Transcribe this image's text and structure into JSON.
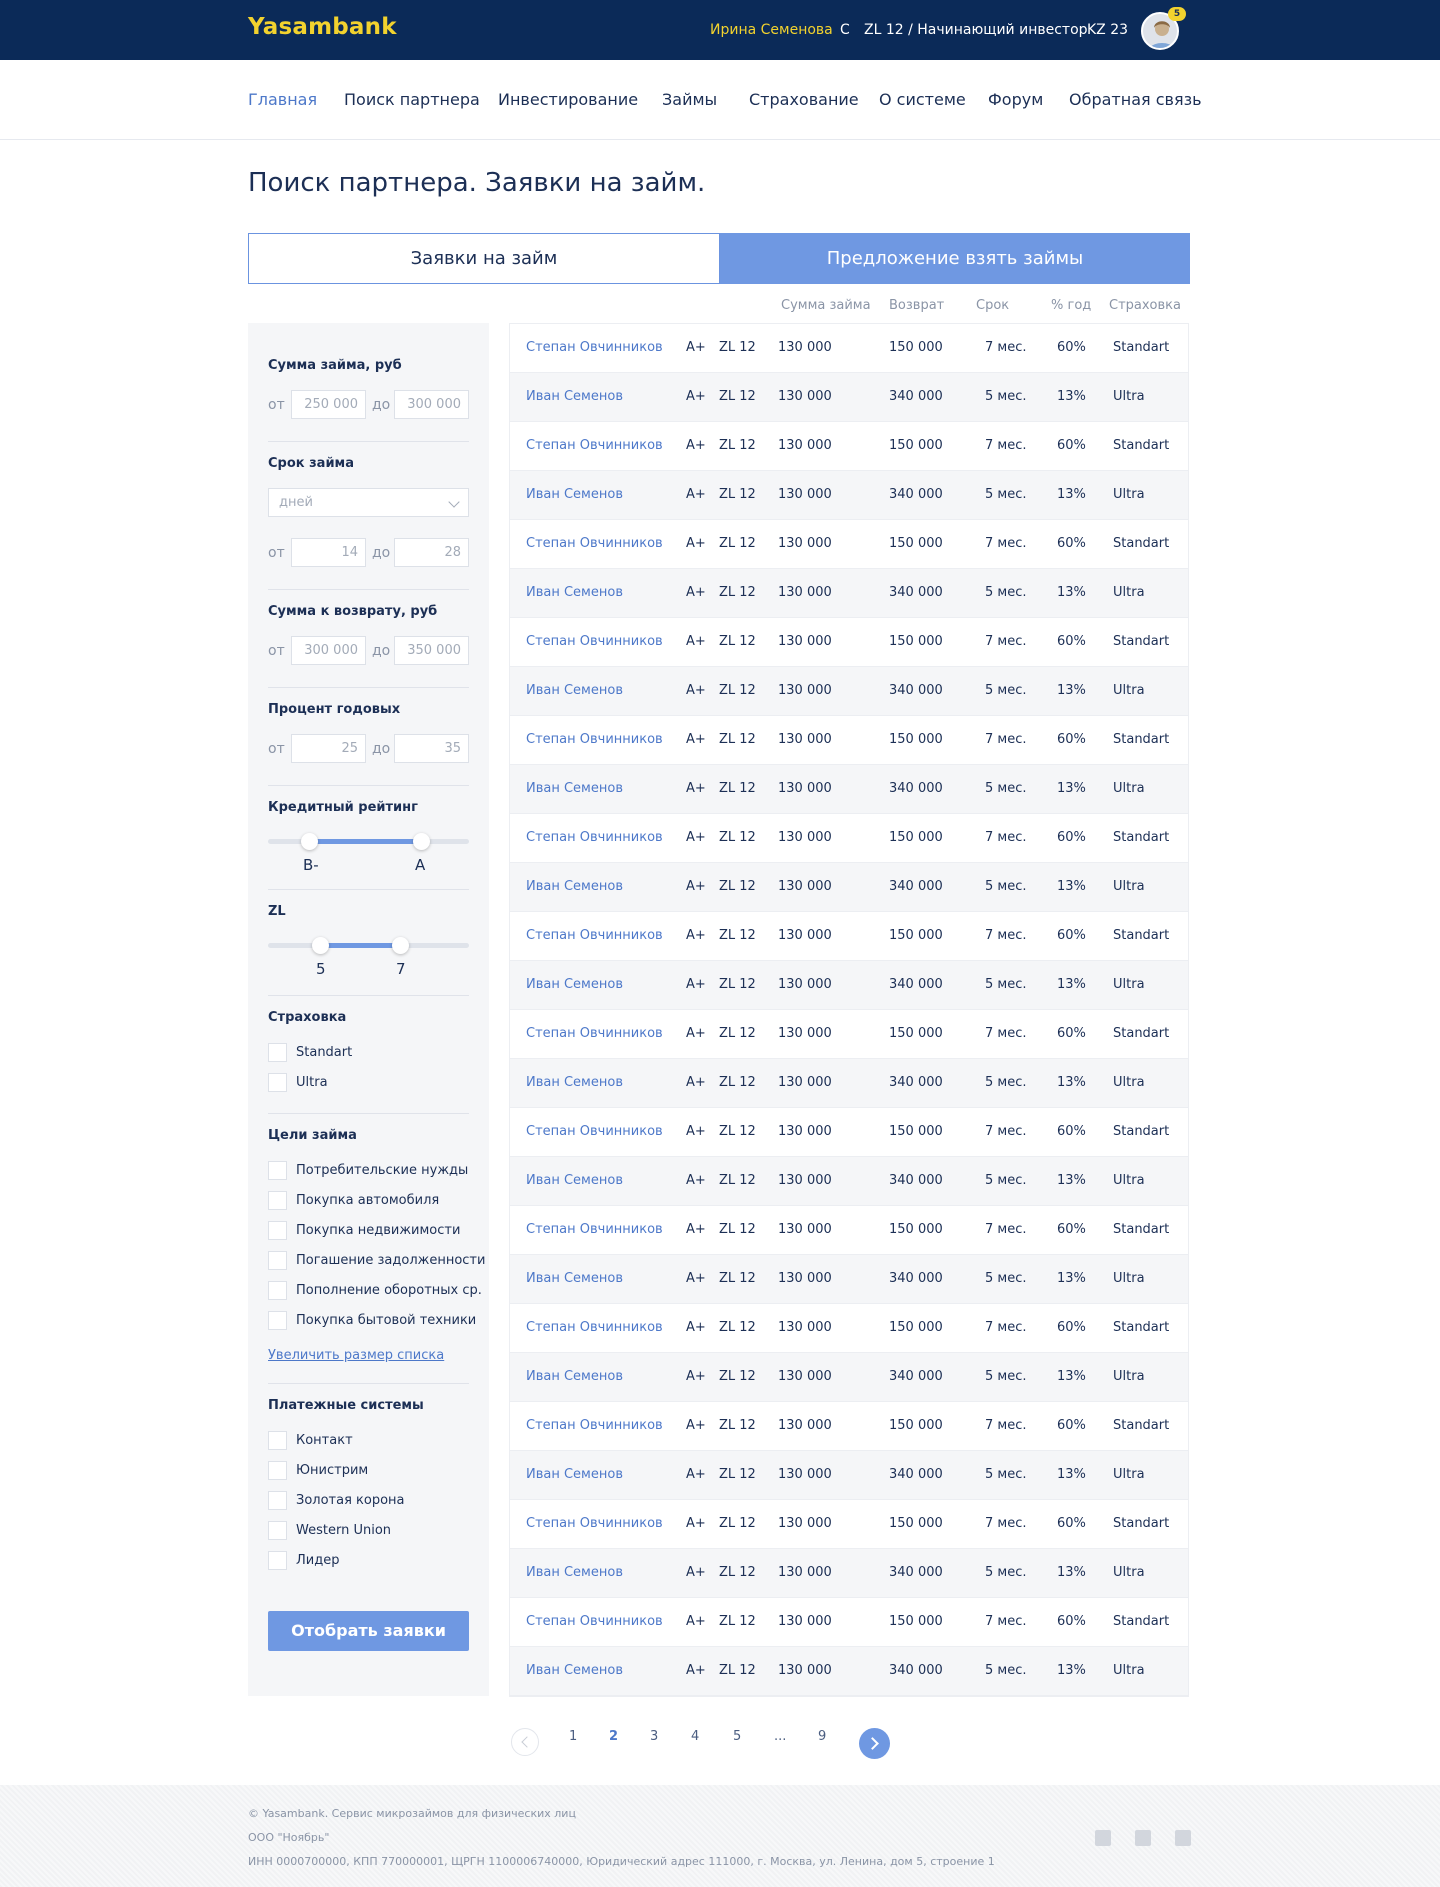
{
  "header": {
    "logo": "Yasambank",
    "user_name": "Ирина Семенова",
    "rank": "C",
    "zl_status": "ZL 12 / Начинающий инвестор",
    "kz": "KZ 23",
    "notifications": "5"
  },
  "nav": {
    "items": [
      "Главная",
      "Поиск партнера",
      "Инвестирование",
      "Займы",
      "Страхование",
      "О системе",
      "Форум",
      "Обратная связь"
    ],
    "active": 0
  },
  "page": {
    "title": "Поиск партнера. Заявки на займ."
  },
  "tabs": [
    "Заявки на займ",
    "Предложение взять займы"
  ],
  "columns": {
    "amount": "Сумма займа",
    "return": "Возврат",
    "term": "Срок",
    "rate": "% год",
    "insurance": "Страховка"
  },
  "filters": {
    "sum_label": "Сумма займа, руб",
    "from": "от",
    "to": "до",
    "sum_from": "250 000",
    "sum_to": "300 000",
    "term_label": "Срок займа",
    "term_unit": "дней",
    "term_from": "14",
    "term_to": "28",
    "return_label": "Сумма к возврату, руб",
    "return_from": "300 000",
    "return_to": "350 000",
    "rate_label": "Процент годовых",
    "rate_from": "25",
    "rate_to": "35",
    "rating_label": "Кредитный рейтинг",
    "rating_min": "B-",
    "rating_max": "A",
    "zl_label": "ZL",
    "zl_min": "5",
    "zl_max": "7",
    "insurance_label": "Страховка",
    "insurance_options": [
      "Standart",
      "Ultra"
    ],
    "goals_label": "Цели займа",
    "goals": [
      "Потребительские нужды",
      "Покупка автомобиля",
      "Покупка недвижимости",
      "Погашение задолженности",
      "Пополнение оборотных ср.",
      "Покупка бытовой техники"
    ],
    "more_link": "Увеличить размер списка",
    "payments_label": "Платежные системы",
    "payments": [
      "Контакт",
      "Юнистрим",
      "Золотая корона",
      "Western Union",
      "Лидер"
    ],
    "submit": "Отобрать заявки"
  },
  "rows": [
    {
      "name": "Степан Овчинников",
      "rating": "A+",
      "zl": "ZL 12",
      "amount": "130 000",
      "return": "150 000",
      "term": "7 мес.",
      "rate": "60%",
      "insurance": "Standart"
    },
    {
      "name": "Иван Семенов",
      "rating": "A+",
      "zl": "ZL 12",
      "amount": "130 000",
      "return": "340 000",
      "term": "5 мес.",
      "rate": "13%",
      "insurance": "Ultra"
    },
    {
      "name": "Степан Овчинников",
      "rating": "A+",
      "zl": "ZL 12",
      "amount": "130 000",
      "return": "150 000",
      "term": "7 мес.",
      "rate": "60%",
      "insurance": "Standart"
    },
    {
      "name": "Иван Семенов",
      "rating": "A+",
      "zl": "ZL 12",
      "amount": "130 000",
      "return": "340 000",
      "term": "5 мес.",
      "rate": "13%",
      "insurance": "Ultra"
    },
    {
      "name": "Степан Овчинников",
      "rating": "A+",
      "zl": "ZL 12",
      "amount": "130 000",
      "return": "150 000",
      "term": "7 мес.",
      "rate": "60%",
      "insurance": "Standart"
    },
    {
      "name": "Иван Семенов",
      "rating": "A+",
      "zl": "ZL 12",
      "amount": "130 000",
      "return": "340 000",
      "term": "5 мес.",
      "rate": "13%",
      "insurance": "Ultra"
    },
    {
      "name": "Степан Овчинников",
      "rating": "A+",
      "zl": "ZL 12",
      "amount": "130 000",
      "return": "150 000",
      "term": "7 мес.",
      "rate": "60%",
      "insurance": "Standart"
    },
    {
      "name": "Иван Семенов",
      "rating": "A+",
      "zl": "ZL 12",
      "amount": "130 000",
      "return": "340 000",
      "term": "5 мес.",
      "rate": "13%",
      "insurance": "Ultra"
    },
    {
      "name": "Степан Овчинников",
      "rating": "A+",
      "zl": "ZL 12",
      "amount": "130 000",
      "return": "150 000",
      "term": "7 мес.",
      "rate": "60%",
      "insurance": "Standart"
    },
    {
      "name": "Иван Семенов",
      "rating": "A+",
      "zl": "ZL 12",
      "amount": "130 000",
      "return": "340 000",
      "term": "5 мес.",
      "rate": "13%",
      "insurance": "Ultra"
    },
    {
      "name": "Степан Овчинников",
      "rating": "A+",
      "zl": "ZL 12",
      "amount": "130 000",
      "return": "150 000",
      "term": "7 мес.",
      "rate": "60%",
      "insurance": "Standart"
    },
    {
      "name": "Иван Семенов",
      "rating": "A+",
      "zl": "ZL 12",
      "amount": "130 000",
      "return": "340 000",
      "term": "5 мес.",
      "rate": "13%",
      "insurance": "Ultra"
    },
    {
      "name": "Степан Овчинников",
      "rating": "A+",
      "zl": "ZL 12",
      "amount": "130 000",
      "return": "150 000",
      "term": "7 мес.",
      "rate": "60%",
      "insurance": "Standart"
    },
    {
      "name": "Иван Семенов",
      "rating": "A+",
      "zl": "ZL 12",
      "amount": "130 000",
      "return": "340 000",
      "term": "5 мес.",
      "rate": "13%",
      "insurance": "Ultra"
    },
    {
      "name": "Степан Овчинников",
      "rating": "A+",
      "zl": "ZL 12",
      "amount": "130 000",
      "return": "150 000",
      "term": "7 мес.",
      "rate": "60%",
      "insurance": "Standart"
    },
    {
      "name": "Иван Семенов",
      "rating": "A+",
      "zl": "ZL 12",
      "amount": "130 000",
      "return": "340 000",
      "term": "5 мес.",
      "rate": "13%",
      "insurance": "Ultra"
    },
    {
      "name": "Степан Овчинников",
      "rating": "A+",
      "zl": "ZL 12",
      "amount": "130 000",
      "return": "150 000",
      "term": "7 мес.",
      "rate": "60%",
      "insurance": "Standart"
    },
    {
      "name": "Иван Семенов",
      "rating": "A+",
      "zl": "ZL 12",
      "amount": "130 000",
      "return": "340 000",
      "term": "5 мес.",
      "rate": "13%",
      "insurance": "Ultra"
    },
    {
      "name": "Степан Овчинников",
      "rating": "A+",
      "zl": "ZL 12",
      "amount": "130 000",
      "return": "150 000",
      "term": "7 мес.",
      "rate": "60%",
      "insurance": "Standart"
    },
    {
      "name": "Иван Семенов",
      "rating": "A+",
      "zl": "ZL 12",
      "amount": "130 000",
      "return": "340 000",
      "term": "5 мес.",
      "rate": "13%",
      "insurance": "Ultra"
    },
    {
      "name": "Степан Овчинников",
      "rating": "A+",
      "zl": "ZL 12",
      "amount": "130 000",
      "return": "150 000",
      "term": "7 мес.",
      "rate": "60%",
      "insurance": "Standart"
    },
    {
      "name": "Иван Семенов",
      "rating": "A+",
      "zl": "ZL 12",
      "amount": "130 000",
      "return": "340 000",
      "term": "5 мес.",
      "rate": "13%",
      "insurance": "Ultra"
    },
    {
      "name": "Степан Овчинников",
      "rating": "A+",
      "zl": "ZL 12",
      "amount": "130 000",
      "return": "150 000",
      "term": "7 мес.",
      "rate": "60%",
      "insurance": "Standart"
    },
    {
      "name": "Иван Семенов",
      "rating": "A+",
      "zl": "ZL 12",
      "amount": "130 000",
      "return": "340 000",
      "term": "5 мес.",
      "rate": "13%",
      "insurance": "Ultra"
    },
    {
      "name": "Степан Овчинников",
      "rating": "A+",
      "zl": "ZL 12",
      "amount": "130 000",
      "return": "150 000",
      "term": "7 мес.",
      "rate": "60%",
      "insurance": "Standart"
    },
    {
      "name": "Иван Семенов",
      "rating": "A+",
      "zl": "ZL 12",
      "amount": "130 000",
      "return": "340 000",
      "term": "5 мес.",
      "rate": "13%",
      "insurance": "Ultra"
    },
    {
      "name": "Степан Овчинников",
      "rating": "A+",
      "zl": "ZL 12",
      "amount": "130 000",
      "return": "150 000",
      "term": "7 мес.",
      "rate": "60%",
      "insurance": "Standart"
    },
    {
      "name": "Иван Семенов",
      "rating": "A+",
      "zl": "ZL 12",
      "amount": "130 000",
      "return": "340 000",
      "term": "5 мес.",
      "rate": "13%",
      "insurance": "Ultra"
    }
  ],
  "pagination": {
    "pages": [
      "1",
      "2",
      "3",
      "4",
      "5",
      "...",
      "9"
    ],
    "current": "2"
  },
  "footer": {
    "line1": "© Yasambank. Сервис микрозаймов для физических лиц",
    "line2": "ООО \"Ноябрь\"",
    "line3": "ИНН 0000700000, КПП 770000001, ЩРГН 1100006740000, Юридический адрес 111000, г. Москва, ул. Ленина, дом 5, строение 1"
  },
  "icons": {
    "social": [
      "facebook-icon",
      "twitter-icon",
      "instagram-icon"
    ]
  },
  "colors": {
    "header": "#0b2a58",
    "brand": "#f2d22e",
    "accent": "#6f98e2",
    "link": "#4d78c9"
  }
}
